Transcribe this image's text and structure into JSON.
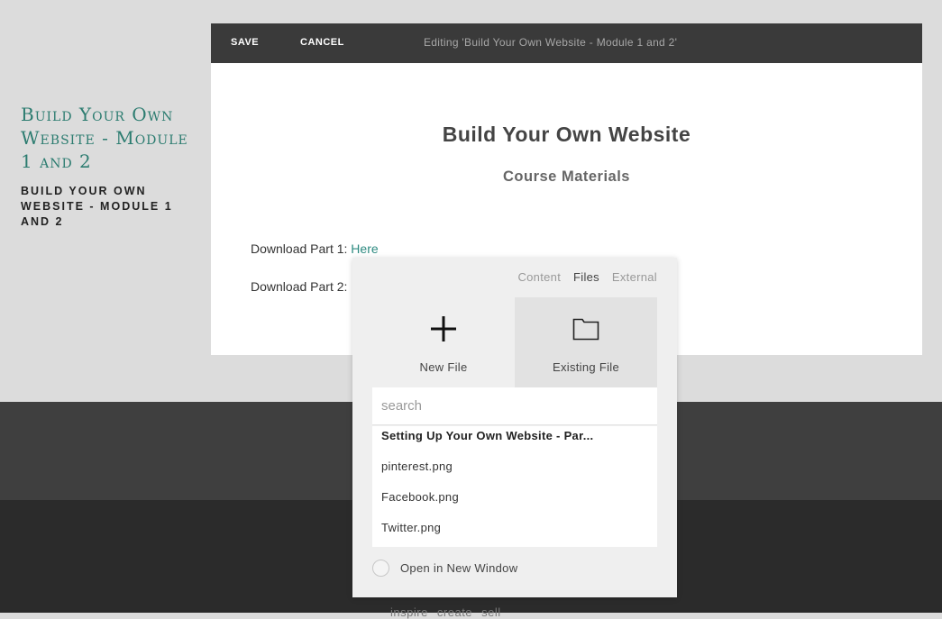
{
  "site": {
    "title": "Build Your Own Website - Module 1 and 2",
    "subtitle": "BUILD YOUR OWN WEBSITE - MODULE 1 AND 2"
  },
  "editor_bar": {
    "save_label": "SAVE",
    "cancel_label": "CANCEL",
    "editing_title": "Editing 'Build Your Own Website - Module 1 and 2'"
  },
  "content": {
    "title": "Build Your Own Website",
    "subtitle": "Course Materials",
    "download_part1_label": "Download Part 1: ",
    "download_part1_link": "Here",
    "download_part2_label": "Download Part 2:"
  },
  "link_panel": {
    "tabs": [
      {
        "label": "Content",
        "active": false
      },
      {
        "label": "Files",
        "active": true
      },
      {
        "label": "External",
        "active": false
      }
    ],
    "new_file_label": "New File",
    "new_file_icon": "plus-icon",
    "existing_file_label": "Existing File",
    "existing_file_icon": "folder-icon",
    "search_placeholder": "search",
    "files": [
      "Setting Up Your Own Website - Par...",
      "pinterest.png",
      "Facebook.png",
      "Twitter.png"
    ],
    "open_new_window_label": "Open in New Window"
  },
  "footer": {
    "links": "inspire  create  sell"
  },
  "colors": {
    "accent": "#2d8a80",
    "editor_bar": "#3a3a3a",
    "footer_dark": "#2b2b2b"
  }
}
